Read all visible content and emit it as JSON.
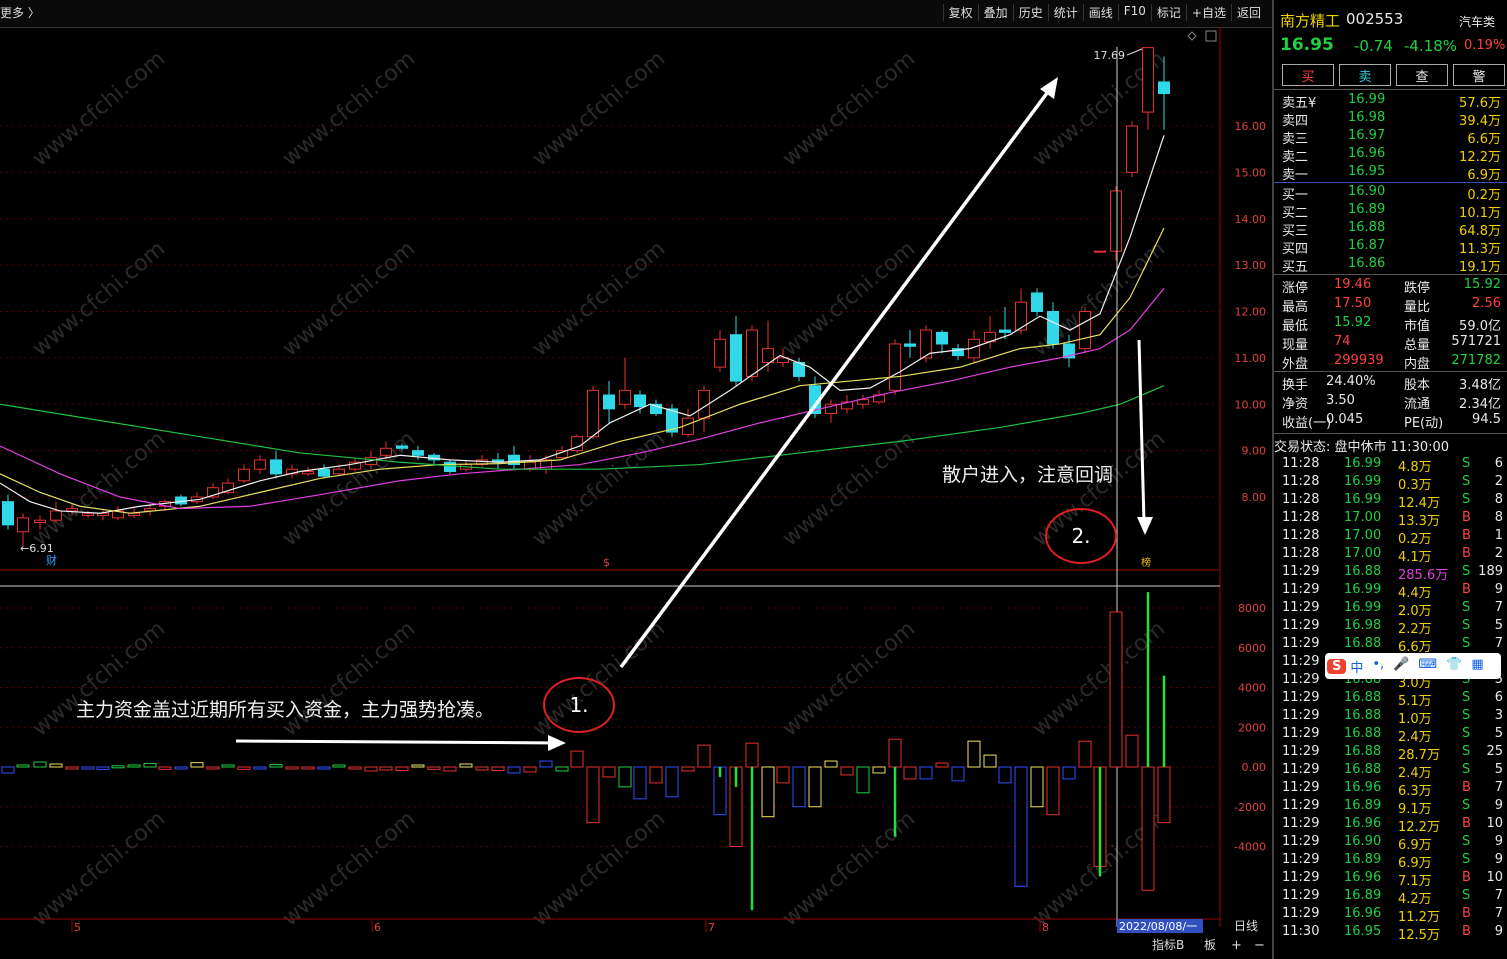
{
  "topbar": {
    "more": "更多 〉",
    "tools": [
      "复权",
      "叠加",
      "历史",
      "统计",
      "画线",
      "F10",
      "标记",
      "+自选",
      "返回"
    ]
  },
  "chart": {
    "price_axis": [
      "16.00",
      "15.00",
      "14.00",
      "13.00",
      "12.00",
      "11.00",
      "10.00",
      "9.00",
      "8.00"
    ],
    "vol_axis": [
      "8000",
      "6000",
      "4000",
      "2000",
      "0.00",
      "-2000",
      "-4000"
    ],
    "month_labels": [
      "5",
      "6",
      "7",
      "8"
    ],
    "high_label": "17.69",
    "low_label": "←6.91",
    "cai_label": "财",
    "s_label": "$",
    "bang_label": "榜",
    "date_label": "2022/08/08/一",
    "period_label": "日线",
    "indicator_label": "指标B",
    "board_label": "板",
    "plus": "+",
    "minus": "−"
  },
  "annotations": {
    "a1": "主力资金盖过近期所有买入资金，主力强势抢凑。",
    "c1": "1.",
    "a2": "散户进入，注意回调",
    "c2": "2."
  },
  "watermark": "www.cfchi.com",
  "quote": {
    "name": "南方精工",
    "code": "002553",
    "sector": "汽车类",
    "price": "16.95",
    "change": "-0.74",
    "pct": "-4.18%",
    "ratio": "0.19%",
    "buttons": [
      "买",
      "卖",
      "查",
      "警"
    ],
    "asks": [
      [
        "卖五¥",
        "16.99",
        "57.6万"
      ],
      [
        "卖四",
        "16.98",
        "39.4万"
      ],
      [
        "卖三",
        "16.97",
        "6.6万"
      ],
      [
        "卖二",
        "16.96",
        "12.2万"
      ],
      [
        "卖一",
        "16.95",
        "6.9万"
      ]
    ],
    "bids": [
      [
        "买一",
        "16.90",
        "0.2万"
      ],
      [
        "买二",
        "16.89",
        "10.1万"
      ],
      [
        "买三",
        "16.88",
        "64.8万"
      ],
      [
        "买四",
        "16.87",
        "11.3万"
      ],
      [
        "买五",
        "16.86",
        "19.1万"
      ]
    ],
    "stats": [
      [
        "涨停",
        "19.46",
        "跌停",
        "15.92"
      ],
      [
        "最高",
        "17.50",
        "量比",
        "2.56"
      ],
      [
        "最低",
        "15.92",
        "市值",
        "59.0亿"
      ],
      [
        "现量",
        "74",
        "总量",
        "571721"
      ],
      [
        "外盘",
        "299939",
        "内盘",
        "271782"
      ]
    ],
    "fund": [
      [
        "换手",
        "24.40%",
        "股本",
        "3.48亿"
      ],
      [
        "净资",
        "3.50",
        "流通",
        "2.34亿"
      ],
      [
        "收益(一)",
        "0.045",
        "PE(动)",
        "94.5"
      ]
    ],
    "status": "交易状态: 盘中休市 11:30:00",
    "ticks": [
      [
        "11:28",
        "16.99",
        "4.8万",
        "S",
        "6"
      ],
      [
        "11:28",
        "16.99",
        "0.3万",
        "S",
        "2"
      ],
      [
        "11:28",
        "16.99",
        "12.4万",
        "S",
        "8"
      ],
      [
        "11:28",
        "17.00",
        "13.3万",
        "B",
        "8"
      ],
      [
        "11:28",
        "17.00",
        "0.2万",
        "B",
        "1"
      ],
      [
        "11:28",
        "17.00",
        "4.1万",
        "B",
        "2"
      ],
      [
        "11:29",
        "16.88",
        "285.6万",
        "S",
        "189"
      ],
      [
        "11:29",
        "16.99",
        "4.4万",
        "B",
        "9"
      ],
      [
        "11:29",
        "16.99",
        "2.0万",
        "S",
        "7"
      ],
      [
        "11:29",
        "16.98",
        "2.2万",
        "S",
        "5"
      ],
      [
        "11:29",
        "16.88",
        "6.6万",
        "S",
        "7"
      ],
      [
        "11:29",
        "",
        "",
        "",
        ""
      ],
      [
        "11:29",
        "16.88",
        "3.0万",
        "S",
        "5"
      ],
      [
        "11:29",
        "16.88",
        "5.1万",
        "S",
        "6"
      ],
      [
        "11:29",
        "16.88",
        "1.0万",
        "S",
        "3"
      ],
      [
        "11:29",
        "16.88",
        "2.4万",
        "S",
        "5"
      ],
      [
        "11:29",
        "16.88",
        "28.7万",
        "S",
        "25"
      ],
      [
        "11:29",
        "16.88",
        "2.4万",
        "S",
        "5"
      ],
      [
        "11:29",
        "16.96",
        "6.3万",
        "B",
        "7"
      ],
      [
        "11:29",
        "16.89",
        "9.1万",
        "S",
        "9"
      ],
      [
        "11:29",
        "16.96",
        "12.2万",
        "B",
        "10"
      ],
      [
        "11:29",
        "16.90",
        "6.9万",
        "S",
        "9"
      ],
      [
        "11:29",
        "16.89",
        "6.9万",
        "S",
        "9"
      ],
      [
        "11:29",
        "16.96",
        "7.1万",
        "B",
        "10"
      ],
      [
        "11:29",
        "16.89",
        "4.2万",
        "S",
        "7"
      ],
      [
        "11:29",
        "16.96",
        "11.2万",
        "B",
        "7"
      ],
      [
        "11:30",
        "16.95",
        "12.5万",
        "B",
        "9"
      ]
    ]
  },
  "ime": {
    "items": [
      "中",
      "•,",
      "🎤",
      "⌨",
      "👕",
      "▦"
    ]
  }
}
